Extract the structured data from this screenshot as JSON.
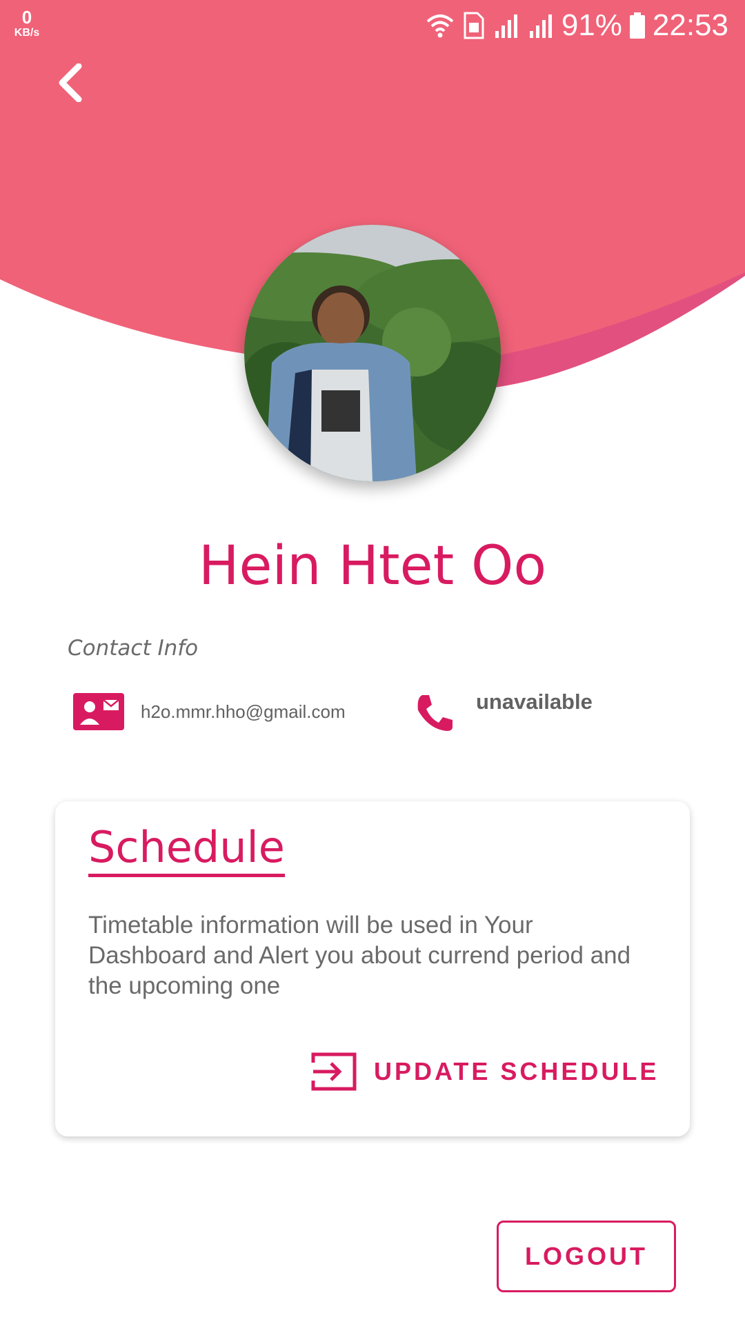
{
  "status_bar": {
    "speed_value": "0",
    "speed_unit": "KB/s",
    "battery": "91%",
    "time": "22:53",
    "icons": [
      "wifi-icon",
      "sim-icon",
      "signal-icon",
      "signal-icon",
      "battery-icon"
    ]
  },
  "header": {
    "back_icon": "chevron-left-icon",
    "colors": {
      "primary": "#f06278",
      "wave": "#e2507f"
    }
  },
  "profile": {
    "name": "Hein Htet Oo",
    "avatar": "profile-photo"
  },
  "contact": {
    "title": "Contact Info",
    "email_icon": "contact-card-icon",
    "email": "h2o.mmr.hho@gmail.com",
    "phone_icon": "phone-icon",
    "phone": "unavailable"
  },
  "schedule": {
    "title": "Schedule",
    "description": "Timetable information will be used in Your Dashboard and Alert you about currend period and the upcoming one",
    "button_icon": "login-icon",
    "button_label": "UPDATE SCHEDULE"
  },
  "logout": {
    "label": "LOGOUT"
  },
  "accent_color": "#d81b60"
}
